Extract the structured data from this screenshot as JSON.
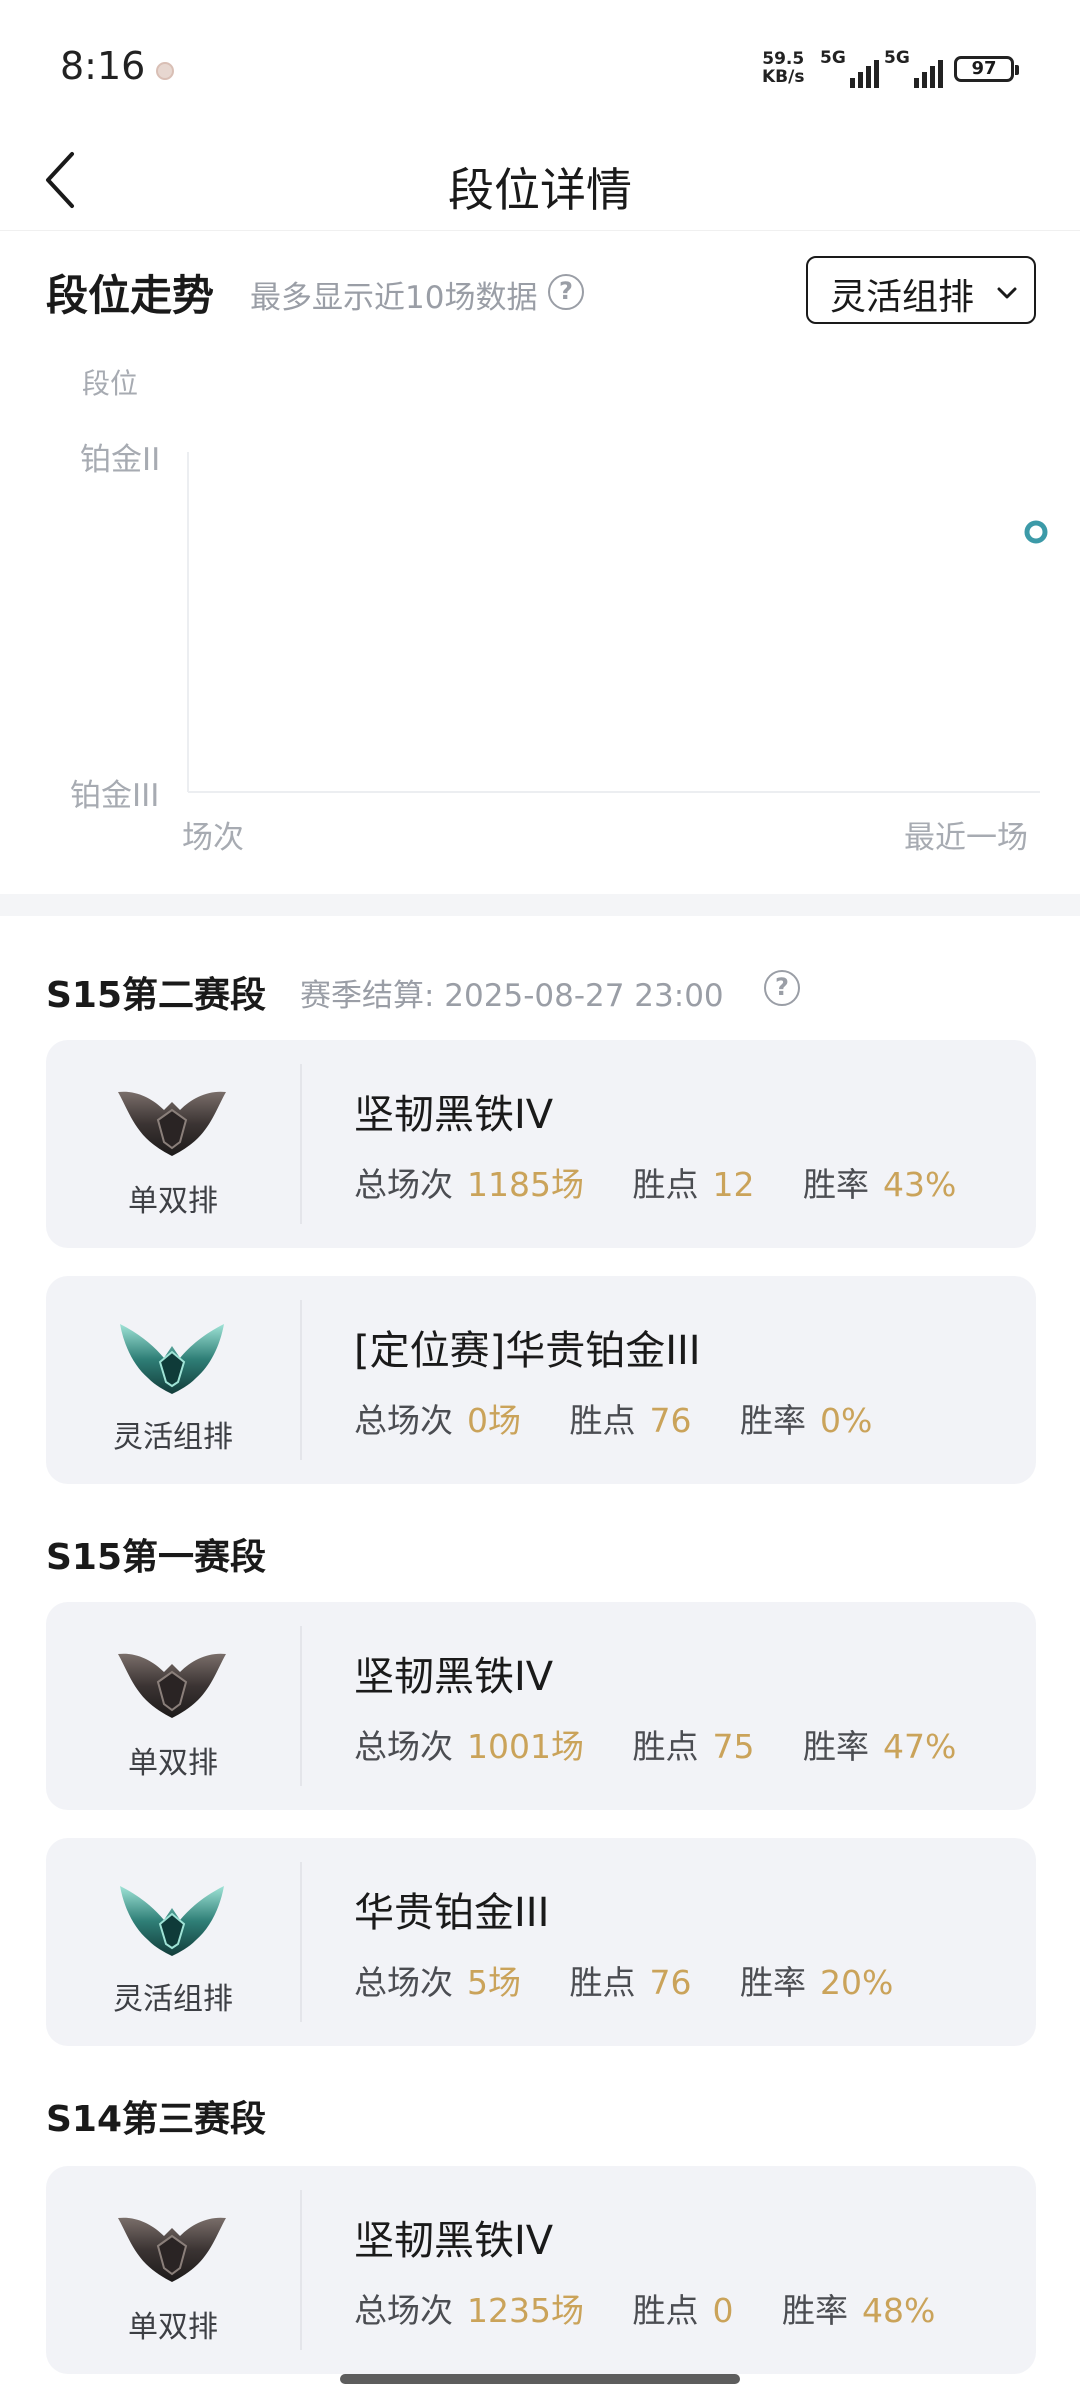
{
  "status_bar": {
    "time": "8:16",
    "net_speed_value": "59.5",
    "net_speed_unit": "KB/s",
    "signal_label": "5G",
    "battery": "97"
  },
  "header": {
    "title": "段位详情"
  },
  "trend": {
    "title": "段位走势",
    "note": "最多显示近10场数据",
    "help": "?",
    "queue_filter": "灵活组排",
    "y_axis_label": "段位",
    "y_top_label": "铂金II",
    "y_bottom_label": "铂金III",
    "x_start_label": "场次",
    "x_end_label": "最近一场",
    "accent_color": "#3c9aa8"
  },
  "chart_data": {
    "type": "line",
    "ylabel": "段位",
    "xlabel": "场次",
    "y_categories": [
      "铂金III",
      "铂金II"
    ],
    "x_labels": [
      "场次",
      "最近一场"
    ],
    "series": [
      {
        "points": [
          {
            "x": "最近一场",
            "y": "铂金II"
          }
        ]
      }
    ]
  },
  "seasons": [
    {
      "title": "S15第二赛段",
      "settlement": "赛季结算: 2025-08-27 23:00",
      "help": "?",
      "cards": [
        {
          "queue": "单双排",
          "rank": "坚韧黑铁IV",
          "games_label": "总场次",
          "games": "1185场",
          "lp_label": "胜点",
          "lp": "12",
          "wr_label": "胜率",
          "wr": "43%",
          "emblem": "iron-emblem"
        },
        {
          "queue": "灵活组排",
          "rank": "[定位赛]华贵铂金III",
          "games_label": "总场次",
          "games": "0场",
          "lp_label": "胜点",
          "lp": "76",
          "wr_label": "胜率",
          "wr": "0%",
          "emblem": "platinum-emblem"
        }
      ]
    },
    {
      "title": "S15第一赛段",
      "cards": [
        {
          "queue": "单双排",
          "rank": "坚韧黑铁IV",
          "games_label": "总场次",
          "games": "1001场",
          "lp_label": "胜点",
          "lp": "75",
          "wr_label": "胜率",
          "wr": "47%",
          "emblem": "iron-emblem"
        },
        {
          "queue": "灵活组排",
          "rank": "华贵铂金III",
          "games_label": "总场次",
          "games": "5场",
          "lp_label": "胜点",
          "lp": "76",
          "wr_label": "胜率",
          "wr": "20%",
          "emblem": "platinum-emblem"
        }
      ]
    },
    {
      "title": "S14第三赛段",
      "cards": [
        {
          "queue": "单双排",
          "rank": "坚韧黑铁IV",
          "games_label": "总场次",
          "games": "1235场",
          "lp_label": "胜点",
          "lp": "0",
          "wr_label": "胜率",
          "wr": "48%",
          "emblem": "iron-emblem"
        }
      ]
    }
  ],
  "colors": {
    "stat_value": "#caa35a",
    "card_bg": "#f2f3f7"
  }
}
